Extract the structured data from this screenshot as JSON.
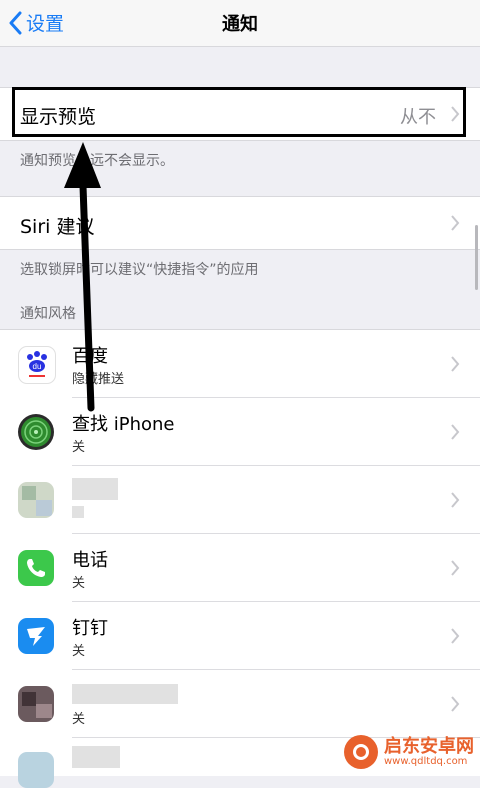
{
  "nav": {
    "back_label": "设置",
    "title": "通知"
  },
  "preview": {
    "label": "显示预览",
    "value": "从不",
    "footer": "通知预览永远不会显示。"
  },
  "siri": {
    "label": "Siri 建议",
    "footer": "选取锁屏时可以建议“快捷指令”的应用"
  },
  "section_header": "通知风格",
  "apps": [
    {
      "name": "百度",
      "subtitle": "隐藏推送"
    },
    {
      "name": "查找 iPhone",
      "subtitle": "关"
    },
    {
      "name": "",
      "subtitle": ""
    },
    {
      "name": "电话",
      "subtitle": "关"
    },
    {
      "name": "钉钉",
      "subtitle": "关"
    },
    {
      "name": "",
      "subtitle": "关"
    }
  ],
  "watermark": {
    "title": "启东安卓网",
    "url": "www.qdltdq.com"
  },
  "colors": {
    "accent": "#1a7cf5",
    "phone_green": "#3cc84b",
    "dingtalk_blue": "#1a8cf0",
    "watermark": "#e8612c"
  }
}
